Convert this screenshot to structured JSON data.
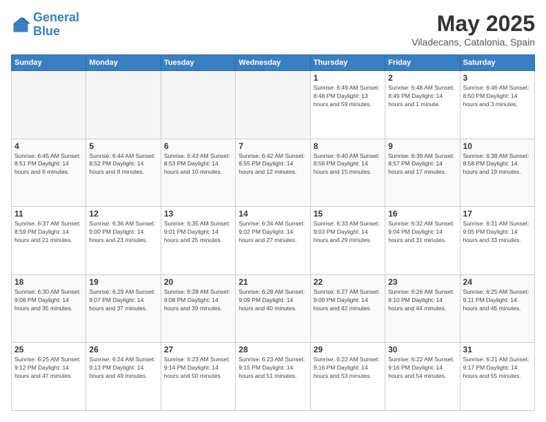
{
  "header": {
    "logo_line1": "General",
    "logo_line2": "Blue",
    "title": "May 2025",
    "subtitle": "Viladecans, Catalonia, Spain"
  },
  "weekdays": [
    "Sunday",
    "Monday",
    "Tuesday",
    "Wednesday",
    "Thursday",
    "Friday",
    "Saturday"
  ],
  "weeks": [
    [
      {
        "day": "",
        "info": ""
      },
      {
        "day": "",
        "info": ""
      },
      {
        "day": "",
        "info": ""
      },
      {
        "day": "",
        "info": ""
      },
      {
        "day": "1",
        "info": "Sunrise: 6:49 AM\nSunset: 8:48 PM\nDaylight: 13 hours\nand 59 minutes."
      },
      {
        "day": "2",
        "info": "Sunrise: 6:48 AM\nSunset: 8:49 PM\nDaylight: 14 hours\nand 1 minute."
      },
      {
        "day": "3",
        "info": "Sunrise: 6:46 AM\nSunset: 8:50 PM\nDaylight: 14 hours\nand 3 minutes."
      }
    ],
    [
      {
        "day": "4",
        "info": "Sunrise: 6:45 AM\nSunset: 8:51 PM\nDaylight: 14 hours\nand 6 minutes."
      },
      {
        "day": "5",
        "info": "Sunrise: 6:44 AM\nSunset: 8:52 PM\nDaylight: 14 hours\nand 8 minutes."
      },
      {
        "day": "6",
        "info": "Sunrise: 6:43 AM\nSunset: 8:53 PM\nDaylight: 14 hours\nand 10 minutes."
      },
      {
        "day": "7",
        "info": "Sunrise: 6:42 AM\nSunset: 8:55 PM\nDaylight: 14 hours\nand 12 minutes."
      },
      {
        "day": "8",
        "info": "Sunrise: 6:40 AM\nSunset: 8:56 PM\nDaylight: 14 hours\nand 15 minutes."
      },
      {
        "day": "9",
        "info": "Sunrise: 6:39 AM\nSunset: 8:57 PM\nDaylight: 14 hours\nand 17 minutes."
      },
      {
        "day": "10",
        "info": "Sunrise: 6:38 AM\nSunset: 8:58 PM\nDaylight: 14 hours\nand 19 minutes."
      }
    ],
    [
      {
        "day": "11",
        "info": "Sunrise: 6:37 AM\nSunset: 8:59 PM\nDaylight: 14 hours\nand 21 minutes."
      },
      {
        "day": "12",
        "info": "Sunrise: 6:36 AM\nSunset: 9:00 PM\nDaylight: 14 hours\nand 23 minutes."
      },
      {
        "day": "13",
        "info": "Sunrise: 6:35 AM\nSunset: 9:01 PM\nDaylight: 14 hours\nand 25 minutes."
      },
      {
        "day": "14",
        "info": "Sunrise: 6:34 AM\nSunset: 9:02 PM\nDaylight: 14 hours\nand 27 minutes."
      },
      {
        "day": "15",
        "info": "Sunrise: 6:33 AM\nSunset: 9:03 PM\nDaylight: 14 hours\nand 29 minutes."
      },
      {
        "day": "16",
        "info": "Sunrise: 6:32 AM\nSunset: 9:04 PM\nDaylight: 14 hours\nand 31 minutes."
      },
      {
        "day": "17",
        "info": "Sunrise: 6:31 AM\nSunset: 9:05 PM\nDaylight: 14 hours\nand 33 minutes."
      }
    ],
    [
      {
        "day": "18",
        "info": "Sunrise: 6:30 AM\nSunset: 9:06 PM\nDaylight: 14 hours\nand 35 minutes."
      },
      {
        "day": "19",
        "info": "Sunrise: 6:29 AM\nSunset: 9:07 PM\nDaylight: 14 hours\nand 37 minutes."
      },
      {
        "day": "20",
        "info": "Sunrise: 6:28 AM\nSunset: 9:08 PM\nDaylight: 14 hours\nand 39 minutes."
      },
      {
        "day": "21",
        "info": "Sunrise: 6:28 AM\nSunset: 9:09 PM\nDaylight: 14 hours\nand 40 minutes."
      },
      {
        "day": "22",
        "info": "Sunrise: 6:27 AM\nSunset: 9:09 PM\nDaylight: 14 hours\nand 42 minutes."
      },
      {
        "day": "23",
        "info": "Sunrise: 6:26 AM\nSunset: 9:10 PM\nDaylight: 14 hours\nand 44 minutes."
      },
      {
        "day": "24",
        "info": "Sunrise: 6:25 AM\nSunset: 9:11 PM\nDaylight: 14 hours\nand 45 minutes."
      }
    ],
    [
      {
        "day": "25",
        "info": "Sunrise: 6:25 AM\nSunset: 9:12 PM\nDaylight: 14 hours\nand 47 minutes."
      },
      {
        "day": "26",
        "info": "Sunrise: 6:24 AM\nSunset: 9:13 PM\nDaylight: 14 hours\nand 49 minutes."
      },
      {
        "day": "27",
        "info": "Sunrise: 6:23 AM\nSunset: 9:14 PM\nDaylight: 14 hours\nand 50 minutes."
      },
      {
        "day": "28",
        "info": "Sunrise: 6:23 AM\nSunset: 9:15 PM\nDaylight: 14 hours\nand 51 minutes."
      },
      {
        "day": "29",
        "info": "Sunrise: 6:22 AM\nSunset: 9:16 PM\nDaylight: 14 hours\nand 53 minutes."
      },
      {
        "day": "30",
        "info": "Sunrise: 6:22 AM\nSunset: 9:16 PM\nDaylight: 14 hours\nand 54 minutes."
      },
      {
        "day": "31",
        "info": "Sunrise: 6:21 AM\nSunset: 9:17 PM\nDaylight: 14 hours\nand 55 minutes."
      }
    ]
  ]
}
